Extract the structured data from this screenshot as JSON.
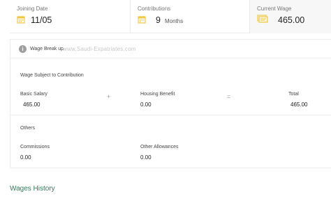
{
  "stats": {
    "joining_date": {
      "label": "Joining Date",
      "value": "11/05"
    },
    "contributions": {
      "label": "Contributions",
      "value": "9",
      "unit": "Months"
    },
    "current_wage": {
      "label": "Current Wage",
      "value": "465.00"
    }
  },
  "breakup": {
    "label": "Wage Break up",
    "watermark": "www.Saudi-Expatriates.com"
  },
  "contribution_section": {
    "title": "Wage Subject to Contribution",
    "basic_salary": {
      "label": "Basic Salary",
      "value": "465.00"
    },
    "plus": "+",
    "housing_benefit": {
      "label": "Housing Benefit",
      "value": "0.00"
    },
    "equals": "=",
    "total": {
      "label": "Total",
      "value": "465.00"
    }
  },
  "others_section": {
    "title": "Others",
    "commissions": {
      "label": "Commissions",
      "value": "0.00"
    },
    "other_allowances": {
      "label": "Other Allowances",
      "value": "0.00"
    }
  },
  "wages_history": {
    "label": "Wages History"
  },
  "colors": {
    "accent_icon": "#f2c744",
    "link_green": "#2e7d5b"
  },
  "icons": [
    "calendar-icon",
    "calendar-icon",
    "wage-icon",
    "info-icon"
  ]
}
